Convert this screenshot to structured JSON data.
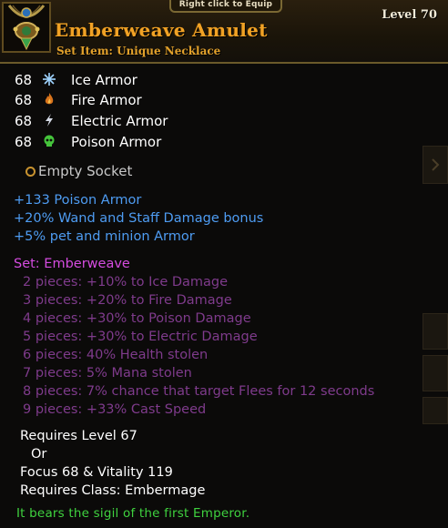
{
  "header": {
    "hint": "Right click to Equip",
    "name": "Emberweave Amulet",
    "type": "Set Item: Unique Necklace",
    "level": "Level 70",
    "icon": "amulet-icon"
  },
  "armor": [
    {
      "value": "68",
      "label": "Ice Armor",
      "icon": "snowflake-icon",
      "color": "#9fd4ff"
    },
    {
      "value": "68",
      "label": "Fire Armor",
      "icon": "flame-icon",
      "color": "#d8731c"
    },
    {
      "value": "68",
      "label": "Electric Armor",
      "icon": "lightning-icon",
      "color": "#d6dbe6"
    },
    {
      "value": "68",
      "label": "Poison Armor",
      "icon": "skull-icon",
      "color": "#45c43b"
    }
  ],
  "socket": "Empty Socket",
  "bonuses": [
    "+133 Poison Armor",
    "+20% Wand and Staff Damage bonus",
    "+5% pet and minion Armor"
  ],
  "set": {
    "title": "Set: Emberweave",
    "pieces": [
      "2 pieces: +10% to Ice Damage",
      "3 pieces: +20% to Fire Damage",
      "4 pieces: +30% to Poison Damage",
      "5 pieces: +30% to Electric Damage",
      "6 pieces: 40% Health stolen",
      "7 pieces: 5% Mana stolen",
      "8 pieces: 7% chance that target Flees for 12 seconds",
      "9 pieces: +33% Cast Speed"
    ]
  },
  "requirements": {
    "level": "Requires Level 67",
    "or": "Or",
    "stats": "Focus 68 & Vitality 119",
    "class": "Requires Class: Embermage"
  },
  "flavor": "It bears the sigil of the first Emperor.",
  "colors": {
    "name": "#f1a225",
    "bonus": "#4e9cf2",
    "set_title": "#d54ce0",
    "set_piece": "#7f3b8c",
    "flavor": "#3fd23f"
  }
}
